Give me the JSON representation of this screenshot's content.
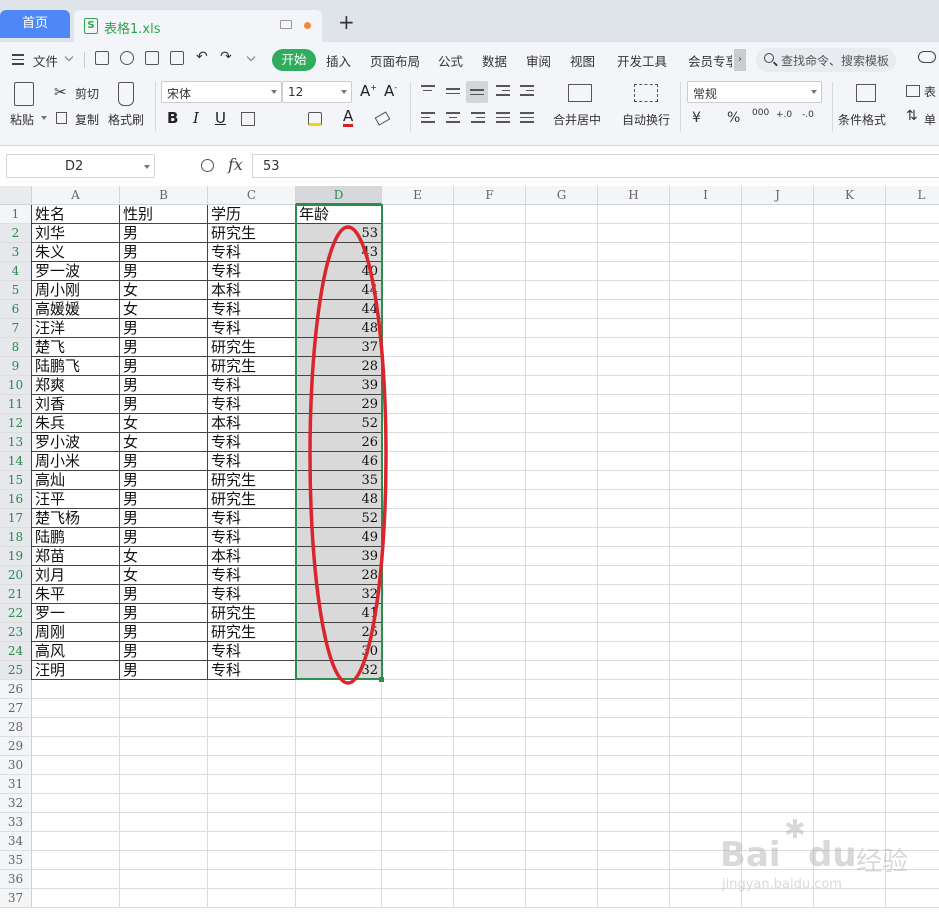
{
  "tabs": {
    "home": "首页",
    "file": "表格1.xls"
  },
  "menu": {
    "file": "文件",
    "items": [
      "开始",
      "插入",
      "页面布局",
      "公式",
      "数据",
      "审阅",
      "视图",
      "开发工具",
      "会员专享"
    ],
    "search_placeholder": "查找命令、搜索模板"
  },
  "toolbar": {
    "paste": "粘贴",
    "cut": "剪切",
    "copy": "复制",
    "format_painter": "格式刷",
    "font_name": "宋体",
    "font_size": "12",
    "merge_center": "合并居中",
    "wrap_text": "自动换行",
    "number_format": "常规",
    "conditional_format": "条件格式",
    "table_style": "表",
    "single": "单",
    "currency": "¥",
    "percent": "%",
    "thousands": "000",
    "inc_decimal": "+.0",
    "dec_decimal": "-.0"
  },
  "formula_bar": {
    "name_box": "D2",
    "fx": "fx",
    "value": "53"
  },
  "grid": {
    "columns": [
      "A",
      "B",
      "C",
      "D",
      "E",
      "F",
      "G",
      "H",
      "I",
      "J",
      "K",
      "L"
    ],
    "active_column": "D",
    "row_count": 37,
    "headers": [
      "姓名",
      "性别",
      "学历",
      "年龄"
    ],
    "rows": [
      [
        "刘华",
        "男",
        "研究生",
        "53"
      ],
      [
        "朱义",
        "男",
        "专科",
        "43"
      ],
      [
        "罗一波",
        "男",
        "专科",
        "40"
      ],
      [
        "周小刚",
        "女",
        "本科",
        "44"
      ],
      [
        "高媛媛",
        "女",
        "专科",
        "44"
      ],
      [
        "汪洋",
        "男",
        "专科",
        "48"
      ],
      [
        "楚飞",
        "男",
        "研究生",
        "37"
      ],
      [
        "陆鹏飞",
        "男",
        "研究生",
        "28"
      ],
      [
        "郑爽",
        "男",
        "专科",
        "39"
      ],
      [
        "刘香",
        "男",
        "专科",
        "29"
      ],
      [
        "朱兵",
        "女",
        "本科",
        "52"
      ],
      [
        "罗小波",
        "女",
        "专科",
        "26"
      ],
      [
        "周小米",
        "男",
        "专科",
        "46"
      ],
      [
        "高灿",
        "男",
        "研究生",
        "35"
      ],
      [
        "汪平",
        "男",
        "研究生",
        "48"
      ],
      [
        "楚飞杨",
        "男",
        "专科",
        "52"
      ],
      [
        "陆鹏",
        "男",
        "专科",
        "49"
      ],
      [
        "郑苗",
        "女",
        "本科",
        "39"
      ],
      [
        "刘月",
        "女",
        "专科",
        "28"
      ],
      [
        "朱平",
        "男",
        "专科",
        "32"
      ],
      [
        "罗一",
        "男",
        "研究生",
        "41"
      ],
      [
        "周刚",
        "男",
        "研究生",
        "25"
      ],
      [
        "高风",
        "男",
        "专科",
        "30"
      ],
      [
        "汪明",
        "男",
        "专科",
        "32"
      ]
    ]
  },
  "watermark": {
    "brand": "Bai",
    "brand2": "du",
    "suffix": "经验",
    "url": "jingyan.baidu.com"
  },
  "colors": {
    "accent_green": "#2fad5d",
    "home_tab": "#4f87f7",
    "selection": "#2e8c4f",
    "annotation_red": "#d9252b"
  }
}
